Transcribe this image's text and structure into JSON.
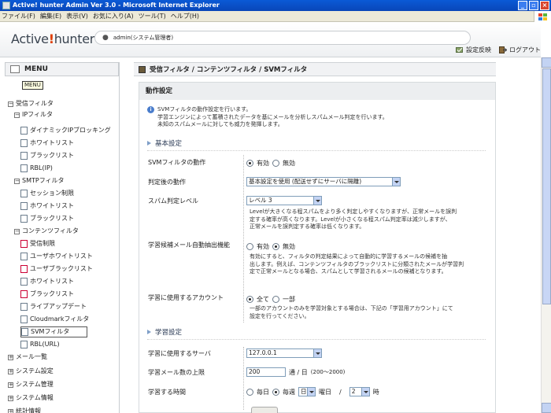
{
  "window": {
    "title": "Active! hunter Admin Ver 3.0 - Microsoft Internet Explorer"
  },
  "menubar": [
    "ファイル(F)",
    "編集(E)",
    "表示(V)",
    "お気に入り(A)",
    "ツール(T)",
    "ヘルプ(H)"
  ],
  "header": {
    "logo_left": "Active",
    "logo_bang": "!",
    "logo_right": "hunter",
    "user": "admin(システム管理者)",
    "apply_label": "設定反映",
    "logout_label": "ログアウト"
  },
  "sidebar": {
    "title": "MENU",
    "tooltip": "MENU",
    "items": [
      {
        "label": "受信フィルタ",
        "level": 0,
        "kind": "folder",
        "toggle": "−"
      },
      {
        "label": "IPフィルタ",
        "level": 1,
        "kind": "folder",
        "toggle": "−"
      },
      {
        "label": "ダイナミックIPブロッキング",
        "level": 2,
        "kind": "doc"
      },
      {
        "label": "ホワイトリスト",
        "level": 2,
        "kind": "doc"
      },
      {
        "label": "ブラックリスト",
        "level": 2,
        "kind": "doc"
      },
      {
        "label": "RBL(IP)",
        "level": 2,
        "kind": "doc"
      },
      {
        "label": "SMTPフィルタ",
        "level": 1,
        "kind": "folder",
        "toggle": "−"
      },
      {
        "label": "セッション制限",
        "level": 2,
        "kind": "doc"
      },
      {
        "label": "ホワイトリスト",
        "level": 2,
        "kind": "doc"
      },
      {
        "label": "ブラックリスト",
        "level": 2,
        "kind": "doc"
      },
      {
        "label": "コンテンツフィルタ",
        "level": 1,
        "kind": "folder",
        "toggle": "−"
      },
      {
        "label": "受信制限",
        "level": 2,
        "kind": "doc-red"
      },
      {
        "label": "ユーザホワイトリスト",
        "level": 2,
        "kind": "doc"
      },
      {
        "label": "ユーザブラックリスト",
        "level": 2,
        "kind": "doc-red"
      },
      {
        "label": "ホワイトリスト",
        "level": 2,
        "kind": "doc"
      },
      {
        "label": "ブラックリスト",
        "level": 2,
        "kind": "doc-red"
      },
      {
        "label": "ライブアップデート",
        "level": 2,
        "kind": "doc"
      },
      {
        "label": "Cloudmarkフィルタ",
        "level": 2,
        "kind": "doc"
      },
      {
        "label": "SVMフィルタ",
        "level": 2,
        "kind": "doc",
        "selected": true
      },
      {
        "label": "RBL(URL)",
        "level": 2,
        "kind": "doc"
      },
      {
        "label": "メール一覧",
        "level": 0,
        "kind": "folder",
        "toggle": "+"
      },
      {
        "label": "システム設定",
        "level": 0,
        "kind": "folder",
        "toggle": "+"
      },
      {
        "label": "システム管理",
        "level": 0,
        "kind": "folder",
        "toggle": "+"
      },
      {
        "label": "システム情報",
        "level": 0,
        "kind": "folder",
        "toggle": "+"
      },
      {
        "label": "統計情報",
        "level": 0,
        "kind": "folder",
        "toggle": "+"
      }
    ]
  },
  "breadcrumb": "受信フィルタ / コンテンツフィルタ / SVMフィルタ",
  "panel": {
    "title": "動作設定",
    "note_lines": [
      "SVMフィルタの動作設定を行います。",
      "学習エンジンによって蓄積されたデータを基にメールを分析しスパムメール判定を行います。",
      "未知のスパムメールに対しても威力を発揮します。"
    ],
    "section_basic": "基本設定",
    "section_learning": "学習設定",
    "rows": {
      "svm_action": {
        "label": "SVMフィルタの動作",
        "opt_on": "有効",
        "opt_off": "無効",
        "selected": "on"
      },
      "after_judge": {
        "label": "判定後の動作",
        "value": "基本設定を使用 (配送せずにサーバに隔離)"
      },
      "spam_level": {
        "label": "スパム判定レベル",
        "value": "レベル 3",
        "desc": [
          "Levelが大きくなる程スパムをより多く判定しやすくなりますが、正常メールを誤判",
          "定する確率が高くなります。Levelが小さくなる程スパム判定率は減少しますが、",
          "正常メールを誤判定する確率は低くなります。"
        ]
      },
      "auto_extract": {
        "label": "学習候補メール自動抽出機能",
        "opt_on": "有効",
        "opt_off": "無効",
        "selected": "off",
        "desc": [
          "有効にすると、フィルタの判定結果によって自動的に学習するメールの候補を抽",
          "出します。例えば、コンテンツフィルタのブラックリストに分類されたメールが学習判",
          "定で正常メールとなる場合、スパムとして学習されるメールの候補となります。"
        ]
      },
      "learn_account": {
        "label": "学習に使用するアカウント",
        "opt_all": "全て",
        "opt_part": "一部",
        "selected": "all",
        "desc": [
          "一部のアカウントのみを学習対象とする場合は、下記の「学習用アカウント」にて",
          "設定を行ってください。"
        ]
      },
      "learn_server": {
        "label": "学習に使用するサーバ",
        "value": "127.0.0.1"
      },
      "learn_limit": {
        "label": "学習メール数の上限",
        "value": "200",
        "unit": "通 / 日",
        "range": "(200～2000)"
      },
      "learn_time": {
        "label": "学習する時間",
        "opt_daily": "毎日",
        "opt_weekly": "毎週",
        "selected": "weekly",
        "weekday_value": "日",
        "weekday_suffix": "曜日",
        "slash": "/",
        "hour_value": "2",
        "hour_suffix": "時"
      }
    }
  }
}
